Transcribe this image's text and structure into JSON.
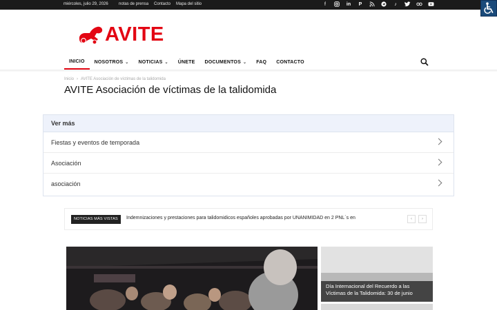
{
  "topbar": {
    "date": "miércoles, julio 29, 2026",
    "links": [
      "notas de prensa",
      "Contacto",
      "Mapa del sitio"
    ]
  },
  "brand": {
    "name": "AVITE",
    "color": "#e30613"
  },
  "nav": {
    "items": [
      {
        "label": "INICIO",
        "active": true,
        "dropdown": false
      },
      {
        "label": "NOSOTROS",
        "active": false,
        "dropdown": true
      },
      {
        "label": "NOTICIAS",
        "active": false,
        "dropdown": true
      },
      {
        "label": "ÚNETE",
        "active": false,
        "dropdown": false
      },
      {
        "label": "DOCUMENTOS",
        "active": false,
        "dropdown": true
      },
      {
        "label": "FAQ",
        "active": false,
        "dropdown": false
      },
      {
        "label": "CONTACTO",
        "active": false,
        "dropdown": false
      }
    ]
  },
  "breadcrumb": {
    "home": "Inicio",
    "separator": "›",
    "current": "AVITE Asociación de víctimas de la talidomida"
  },
  "page_title": "AVITE Asociación de víctimas de la talidomida",
  "ver_mas": {
    "header": "Ver más",
    "items": [
      "Fiestas y eventos de temporada",
      "Asociación",
      "asociación"
    ]
  },
  "ticker": {
    "badge": "NOTICIAS MÁS VISTAS",
    "headline": "Indemnizaciones y prestaciones para talidomidicos españoles aprobadas por UNANIMIDAD en 2 PNL´s en",
    "prev": "‹",
    "next": "›"
  },
  "featured": {
    "side_caption": "Día Internacional del Recuerdo a las Víctimas de la Talidomida: 30 de junio"
  },
  "icons": {
    "socials": [
      "facebook-icon",
      "instagram-icon",
      "linkedin-icon",
      "pinterest-icon",
      "rss-icon",
      "telegram-icon",
      "tiktok-icon",
      "twitter-icon",
      "flickr-icon",
      "youtube-icon"
    ],
    "search": "search-icon",
    "accessibility": "wheelchair-icon"
  }
}
